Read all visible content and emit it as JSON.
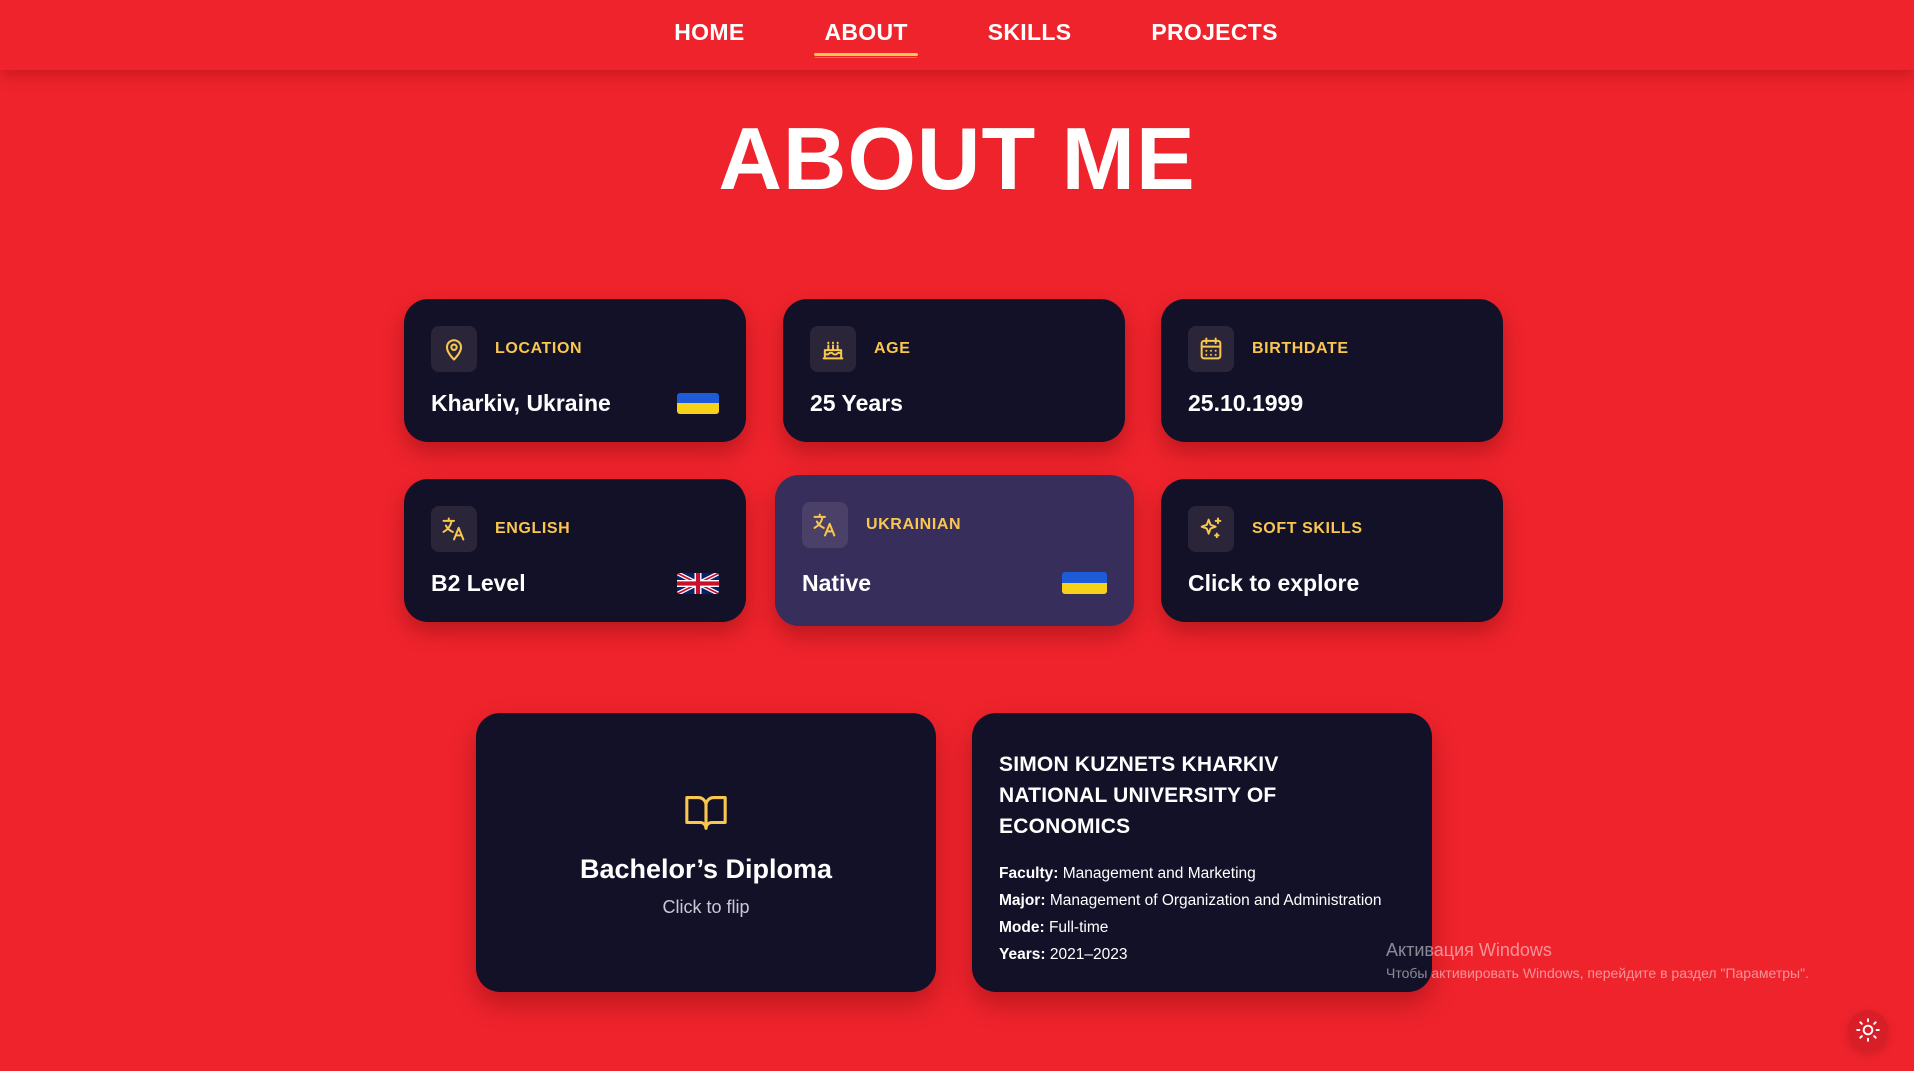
{
  "nav": {
    "items": [
      {
        "label": "HOME"
      },
      {
        "label": "ABOUT"
      },
      {
        "label": "SKILLS"
      },
      {
        "label": "PROJECTS"
      }
    ],
    "active": "ABOUT"
  },
  "page": {
    "title": "ABOUT ME"
  },
  "cards": {
    "location": {
      "label": "LOCATION",
      "value": "Kharkiv, Ukraine",
      "icon": "map-pin-icon",
      "flag": "ukraine-flag"
    },
    "age": {
      "label": "AGE",
      "value": "25 Years",
      "icon": "cake-icon"
    },
    "birthdate": {
      "label": "BIRTHDATE",
      "value": "25.10.1999",
      "icon": "calendar-icon"
    },
    "english": {
      "label": "ENGLISH",
      "value": "B2 Level",
      "icon": "translate-icon",
      "flag": "uk-flag"
    },
    "ukrainian": {
      "label": "UKRAINIAN",
      "value": "Native",
      "icon": "translate-icon",
      "flag": "ukraine-flag"
    },
    "soft_skills": {
      "label": "SOFT SKILLS",
      "value": "Click to explore",
      "icon": "sparkles-icon"
    }
  },
  "education": {
    "diploma": {
      "title": "Bachelor’s Diploma",
      "subtitle": "Click to flip",
      "icon": "book-open-icon"
    },
    "university": {
      "name": "SIMON KUZNETS KHARKIV NATIONAL UNIVERSITY OF ECONOMICS",
      "rows": [
        {
          "key": "Faculty:",
          "value": "Management and Marketing"
        },
        {
          "key": "Major:",
          "value": "Management of Organization and Administration"
        },
        {
          "key": "Mode:",
          "value": "Full-time"
        },
        {
          "key": "Years:",
          "value": "2021–2023"
        }
      ]
    }
  },
  "watermark": {
    "line1": "Активация Windows",
    "line2": "Чтобы активировать Windows, перейдите в раздел \"Параметры\"."
  },
  "colors": {
    "background": "#EF232C",
    "card": "#131128",
    "card_highlight": "#372E5C",
    "accent": "#F9C74F"
  },
  "theme_toggle": {
    "icon": "sun-icon"
  }
}
